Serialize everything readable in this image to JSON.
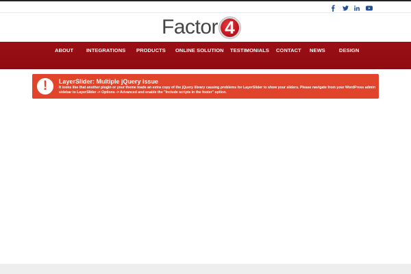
{
  "social": [
    {
      "name": "facebook",
      "glyph": "f"
    },
    {
      "name": "twitter",
      "glyph": "t"
    },
    {
      "name": "linkedin",
      "glyph": "in"
    },
    {
      "name": "youtube",
      "glyph": "▶"
    }
  ],
  "logo": {
    "text": "Factor",
    "number": "4"
  },
  "nav": {
    "items": [
      {
        "label": "ABOUT"
      },
      {
        "label": "INTEGRATIONS"
      },
      {
        "label": "PRODUCTS"
      },
      {
        "label": "ONLINE SOLUTION"
      },
      {
        "label": "TESTIMONIALS"
      },
      {
        "label": "CONTACT"
      },
      {
        "label": "NEWS"
      },
      {
        "label": "DESIGN"
      }
    ]
  },
  "alert": {
    "icon": "!",
    "title": "LayerSlider: Multiple jQuery issue",
    "message": "It looks like that another plugin or your theme loads an extra copy of the jQuery library causing problems for LayerSlider to show your sliders. Please navigate from your WordPress admin sidebar to LayerSlider -> Options -> Advanced and enable the \"Include scripts in the footer\" option."
  },
  "colors": {
    "nav_bg": "#9a0f14",
    "alert_bg": "#e0442b",
    "social_icon": "#1f4f9a"
  }
}
